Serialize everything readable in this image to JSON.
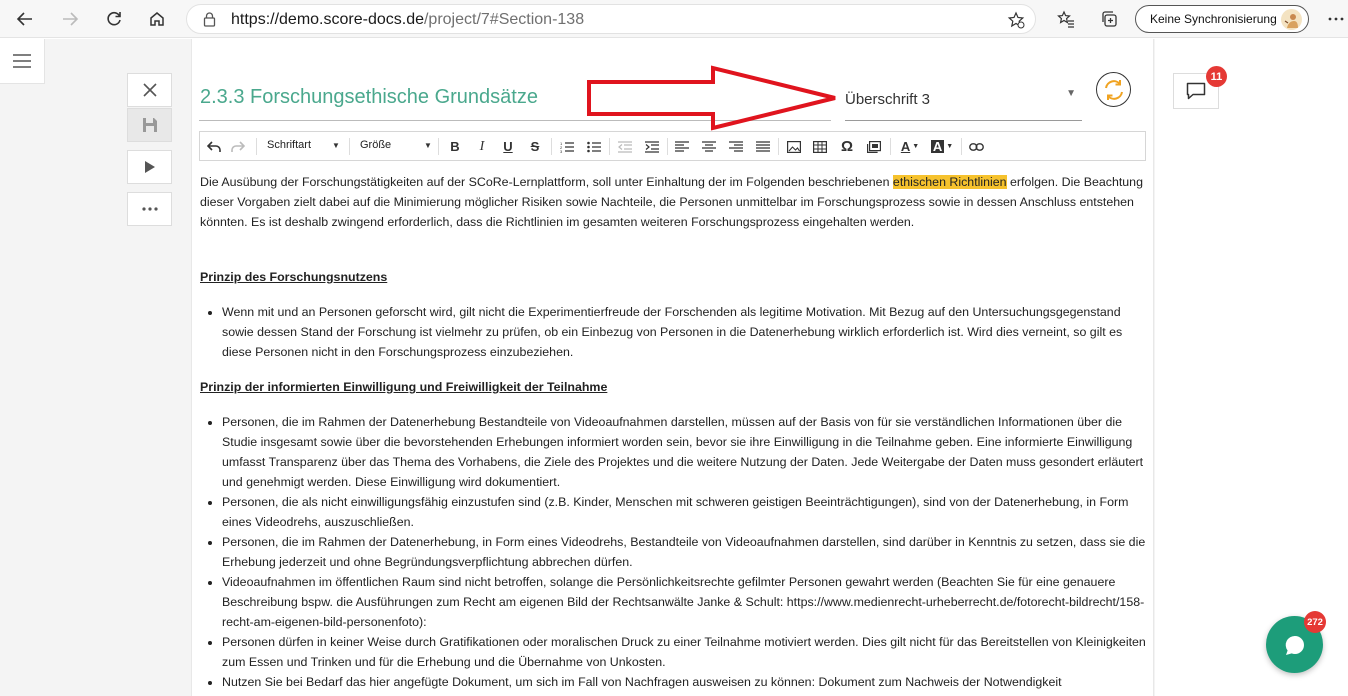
{
  "browser": {
    "url_host": "https://demo.score-docs.de",
    "url_path": "/project/7#Section-138",
    "sync_label": "Keine Synchronisierung",
    "icons": [
      "back-icon",
      "forward-icon",
      "reload-icon",
      "home-icon",
      "lock-icon",
      "favorite-add-icon",
      "favorites-icon",
      "collections-icon",
      "more-icon"
    ]
  },
  "document": {
    "section_title": "2.3.3 Forschungsethische Grundsätze",
    "style_select": "Überschrift 3",
    "toolbar": {
      "font_label": "Schriftart",
      "size_label": "Größe"
    },
    "intro": {
      "before": "Die Ausübung der Forschungstätigkeiten auf der SCoRe-Lernplattform, soll unter Einhaltung der im Folgenden beschriebenen ",
      "highlight": "ethischen Richtlinien",
      "after": " erfolgen. Die Beachtung dieser Vorgaben zielt dabei auf die Minimierung möglicher Risiken sowie Nachteile, die Personen unmittelbar im Forschungsprozess sowie in dessen Anschluss entstehen könnten. Es ist deshalb zwingend erforderlich, dass die Richtlinien im gesamten weiteren Forschungsprozess eingehalten werden."
    },
    "heading1": "Prinzip des Forschungsnutzens",
    "list1": [
      "Wenn mit und an Personen geforscht wird, gilt nicht die Experimentierfreude der Forschenden als legitime Motivation. Mit Bezug auf den Untersuchungsgegenstand sowie dessen Stand der Forschung ist vielmehr zu prüfen, ob ein Einbezug von Personen in die Datenerhebung wirklich erforderlich ist. Wird dies verneint, so gilt es diese Personen nicht in den Forschungsprozess einzubeziehen."
    ],
    "heading2": "Prinzip der informierten Einwilligung und Freiwilligkeit der Teilnahme",
    "list2": [
      "Personen, die im Rahmen der Datenerhebung Bestandteile von Videoaufnahmen darstellen, müssen auf der Basis von für sie verständlichen Informationen über die Studie insgesamt sowie über die bevorstehenden Erhebungen informiert worden sein, bevor sie ihre Einwilligung in die Teilnahme geben. Eine informierte Einwilligung umfasst Transparenz über das Thema des Vorhabens, die Ziele des Projektes und die weitere Nutzung der Daten. Jede Weitergabe der Daten muss gesondert erläutert und genehmigt werden. Diese Einwilligung wird dokumentiert.",
      "Personen, die als nicht einwilligungsfähig einzustufen sind (z.B. Kinder, Menschen mit schweren geistigen Beeinträchtigungen), sind von der Datenerhebung, in Form eines Videodrehs, auszuschließen.",
      "Personen, die im Rahmen der Datenerhebung, in Form eines Videodrehs, Bestandteile von Videoaufnahmen darstellen, sind darüber in Kenntnis zu setzen, dass sie die Erhebung jederzeit und ohne Begründungsverpflichtung abbrechen dürfen.",
      "Videoaufnahmen im öffentlichen Raum sind nicht betroffen, solange die Persönlichkeitsrechte gefilmter Personen gewahrt werden (Beachten Sie für eine genauere Beschreibung bspw. die Ausführungen zum Recht am eigenen Bild der Rechtsanwälte Janke & Schult: https://www.medienrecht-urheberrecht.de/fotorecht-bildrecht/158-recht-am-eigenen-bild-personenfoto):",
      "Personen dürfen in keiner Weise durch Gratifikationen oder moralischen Druck zu einer Teilnahme motiviert werden. Dies gilt nicht für das Bereitstellen von Kleinigkeiten zum Essen und Trinken und für die Erhebung und die Übernahme von Unkosten.",
      "Nutzen Sie bei Bedarf das hier angefügte Dokument, um sich im Fall von Nachfragen ausweisen zu können: Dokument zum Nachweis der Notwendigkeit"
    ]
  },
  "comments": {
    "badge": "11"
  },
  "chat": {
    "badge": "272"
  },
  "colors": {
    "accent": "#4aa88d",
    "highlight": "#f6c22d",
    "badge": "#e53935",
    "chat_fab": "#1d9d7a",
    "annotation_arrow": "#e0141e"
  }
}
